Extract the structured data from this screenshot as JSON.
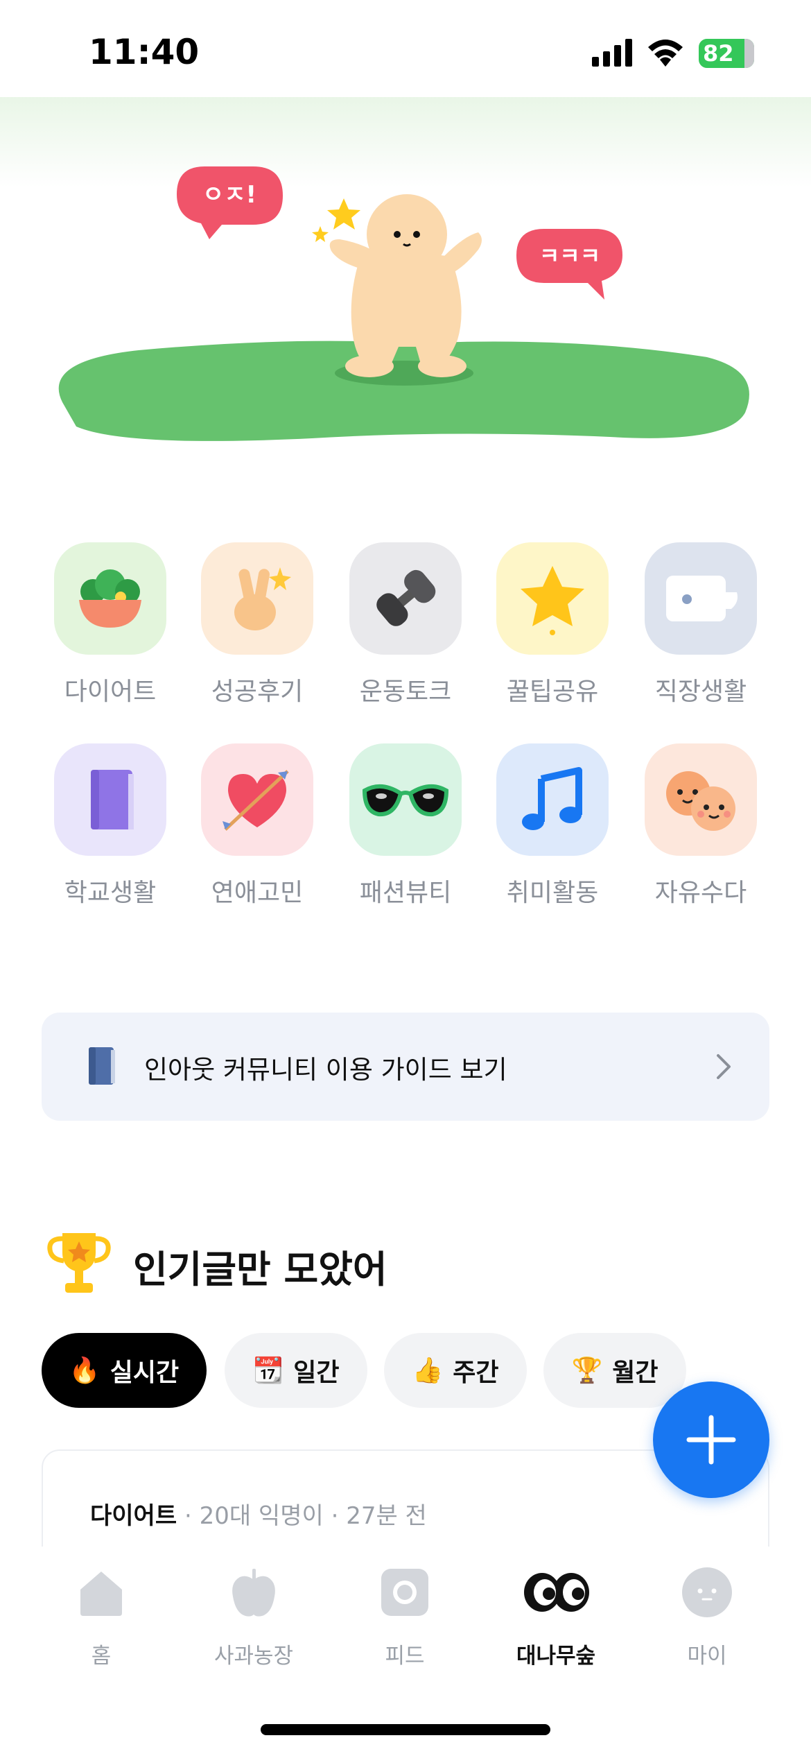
{
  "status_bar": {
    "time": "11:40",
    "battery": "82"
  },
  "hero": {
    "bubble_left": "ㅇㅈ!",
    "bubble_right": "ㅋㅋㅋ"
  },
  "categories": [
    {
      "label": "다이어트",
      "icon": "salad-bowl-icon",
      "bg": "#e3f5dc"
    },
    {
      "label": "성공후기",
      "icon": "victory-hand-icon",
      "bg": "#fdebd8"
    },
    {
      "label": "운동토크",
      "icon": "dumbbell-icon",
      "bg": "#e9e9ec"
    },
    {
      "label": "꿀팁공유",
      "icon": "star-icon",
      "bg": "#fef6c8"
    },
    {
      "label": "직장생활",
      "icon": "coffee-cup-icon",
      "bg": "#dde3ee"
    },
    {
      "label": "학교생활",
      "icon": "book-icon",
      "bg": "#e9e5fb"
    },
    {
      "label": "연애고민",
      "icon": "heart-arrow-icon",
      "bg": "#fde2e5"
    },
    {
      "label": "패션뷰티",
      "icon": "sunglasses-icon",
      "bg": "#d9f4e4"
    },
    {
      "label": "취미활동",
      "icon": "music-note-icon",
      "bg": "#dde9fb"
    },
    {
      "label": "자유수다",
      "icon": "two-faces-icon",
      "bg": "#fde7dc"
    }
  ],
  "guide": {
    "text": "인아웃 커뮤니티 이용 가이드 보기"
  },
  "popular": {
    "title": "인기글만 모았어",
    "chips": [
      {
        "emoji": "🔥",
        "label": "실시간",
        "active": true
      },
      {
        "emoji": "📆",
        "label": "일간",
        "active": false
      },
      {
        "emoji": "👍",
        "label": "주간",
        "active": false
      },
      {
        "emoji": "🏆",
        "label": "월간",
        "active": false
      }
    ]
  },
  "post": {
    "board": "다이어트",
    "author": "20대 익명이",
    "time": "27분 전",
    "separator": "·"
  },
  "tabs": [
    {
      "label": "홈",
      "icon": "home-icon",
      "active": false
    },
    {
      "label": "사과농장",
      "icon": "apple-icon",
      "active": false
    },
    {
      "label": "피드",
      "icon": "camera-icon",
      "active": false
    },
    {
      "label": "대나무숲",
      "icon": "eyes-icon",
      "active": true
    },
    {
      "label": "마이",
      "icon": "profile-face-icon",
      "active": false
    }
  ],
  "colors": {
    "accent": "#1877f2",
    "grass": "#66c26e",
    "bubble": "#f0546a",
    "character": "#fbd9ad"
  }
}
